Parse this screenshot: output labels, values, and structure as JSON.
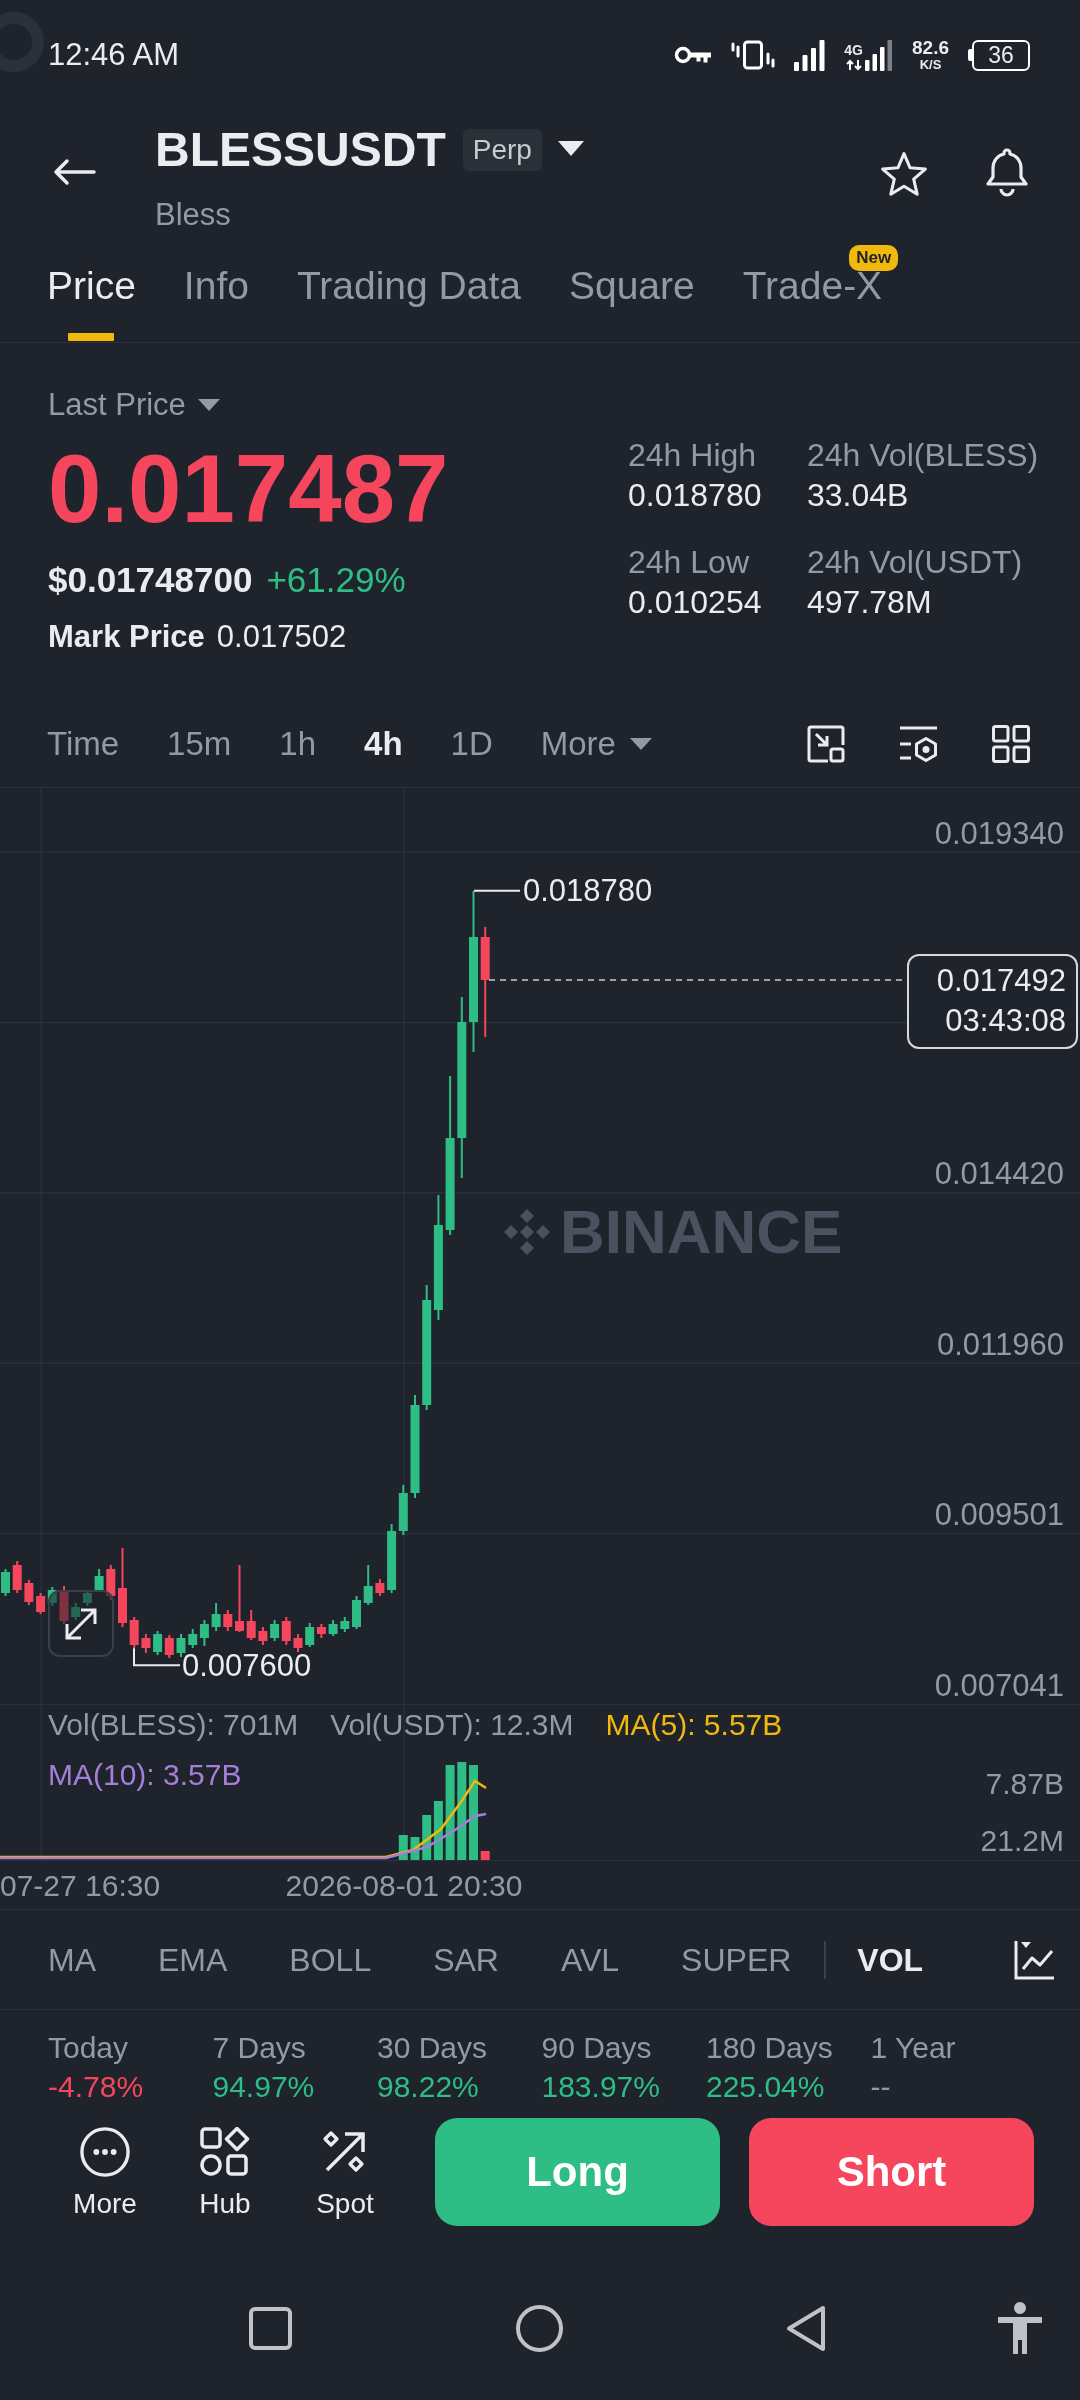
{
  "status_bar": {
    "time": "12:46 AM",
    "network_type": "4G",
    "speed_value": "82.6",
    "speed_unit": "K/S",
    "battery": "36"
  },
  "header": {
    "symbol": "BLESSUSDT",
    "contract_badge": "Perp",
    "name": "Bless"
  },
  "tabs": [
    {
      "label": "Price",
      "selected": true
    },
    {
      "label": "Info",
      "selected": false
    },
    {
      "label": "Trading Data",
      "selected": false
    },
    {
      "label": "Square",
      "selected": false
    },
    {
      "label": "Trade-X",
      "selected": false,
      "badge": "New"
    }
  ],
  "price": {
    "label": "Last Price",
    "value": "0.017487",
    "rising": false,
    "usd_value": "$0.01748700",
    "change": "+61.29%",
    "change_rising": true,
    "mark_label": "Mark Price",
    "mark_value": "0.017502"
  },
  "stats": [
    {
      "label": "24h High",
      "value": "0.018780"
    },
    {
      "label": "24h Vol(BLESS)",
      "value": "33.04B"
    },
    {
      "label": "24h Low",
      "value": "0.010254"
    },
    {
      "label": "24h Vol(USDT)",
      "value": "497.78M"
    }
  ],
  "intervals": [
    {
      "label": "Time",
      "kind": "option",
      "selected": false
    },
    {
      "label": "15m",
      "kind": "option",
      "selected": false
    },
    {
      "label": "1h",
      "kind": "option",
      "selected": false
    },
    {
      "label": "4h",
      "kind": "option",
      "selected": true
    },
    {
      "label": "1D",
      "kind": "option",
      "selected": false
    },
    {
      "label": "More",
      "kind": "menu",
      "selected": false
    }
  ],
  "chart": {
    "price_axis": [
      "0.019340",
      "0.014420",
      "0.011960",
      "0.009501",
      "0.007041"
    ],
    "high_label": "0.018780",
    "low_label": "0.007600",
    "last_price": "0.017492",
    "countdown": "03:43:08",
    "watermark": "BINANCE",
    "volume_legend": [
      {
        "label": "Vol(BLESS): 701M",
        "kind": "volume",
        "color": "#929aa5"
      },
      {
        "label": "Vol(USDT): 12.3M",
        "kind": "volume",
        "color": "#929aa5"
      },
      {
        "label": "MA(5): 5.57B",
        "kind": "ma",
        "color": "#f0b90b"
      },
      {
        "label": "MA(10): 3.57B",
        "kind": "ma",
        "color": "#a57fd7"
      }
    ],
    "volume_axis": [
      "7.87B",
      "21.2M"
    ],
    "time_axis": [
      "07-27 16:30",
      "2026-08-01 20:30"
    ]
  },
  "main_indicators": [
    {
      "label": "MA",
      "selected": false
    },
    {
      "label": "EMA",
      "selected": false
    },
    {
      "label": "BOLL",
      "selected": false
    },
    {
      "label": "SAR",
      "selected": false
    },
    {
      "label": "AVL",
      "selected": false
    },
    {
      "label": "SUPER",
      "selected": false
    }
  ],
  "sub_indicators": [
    {
      "label": "VOL",
      "selected": true
    }
  ],
  "performance": [
    {
      "period": "Today",
      "change": "-4.78%",
      "color": "#f6465d"
    },
    {
      "period": "7 Days",
      "change": "94.97%",
      "color": "#2ebd85"
    },
    {
      "period": "30 Days",
      "change": "98.22%",
      "color": "#2ebd85"
    },
    {
      "period": "90 Days",
      "change": "183.97%",
      "color": "#2ebd85"
    },
    {
      "period": "180 Days",
      "change": "225.04%",
      "color": "#2ebd85"
    },
    {
      "period": "1 Year",
      "change": "--",
      "color": "#929aa5"
    }
  ],
  "toolbar": [
    {
      "label": "More",
      "kind": "dots"
    },
    {
      "label": "Hub",
      "kind": "shapes"
    },
    {
      "label": "Spot",
      "kind": "arrow"
    }
  ],
  "trade_buttons": [
    {
      "label": "Long",
      "kind": "long"
    },
    {
      "label": "Short",
      "kind": "short"
    }
  ]
}
